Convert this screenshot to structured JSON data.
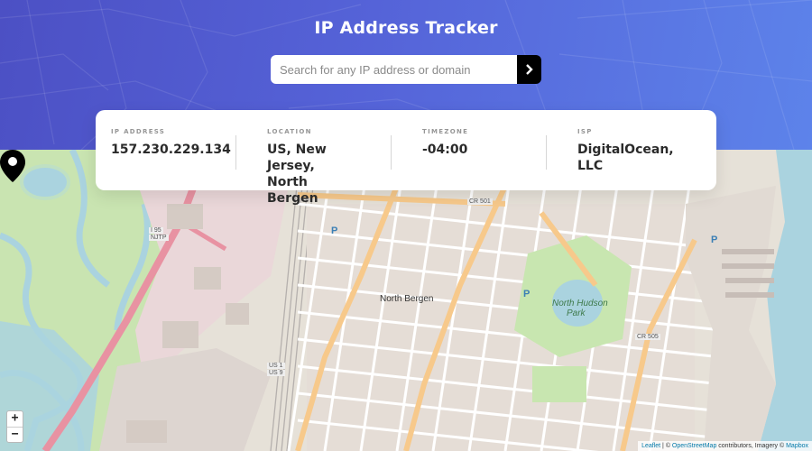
{
  "header": {
    "title": "IP Address Tracker",
    "accent_gradient": [
      "#4c50c4",
      "#5d83ea"
    ]
  },
  "search": {
    "placeholder": "Search for any IP address or domain",
    "value": "",
    "button_icon": "chevron-right-icon"
  },
  "info": {
    "ip_label": "IP ADDRESS",
    "ip_value": "157.230.229.134",
    "location_label": "LOCATION",
    "location_value_lines": [
      "US, New",
      "Jersey,",
      "North",
      "Bergen"
    ],
    "timezone_label": "TIMEZONE",
    "timezone_value": "-04:00",
    "isp_label": "ISP",
    "isp_value_lines": [
      "DigitalOcean,",
      "LLC"
    ]
  },
  "map": {
    "zoom_in": "+",
    "zoom_out": "−",
    "marker_icon": "location-pin-icon",
    "labels": {
      "neighborhood": "North Bergen",
      "park": "North Hudson",
      "park2": "Park",
      "route_cr501": "CR 501",
      "route_cr505": "CR 505",
      "route_i95": "I 95",
      "route_nitp": "NJTP",
      "route_us1": "US 1",
      "route_us9": "US 9",
      "parking": "P"
    },
    "attribution": {
      "leaflet": "Leaflet",
      "sep": " | © ",
      "osm": "OpenStreetMap",
      "mid": " contributors, Imagery © ",
      "mapbox": "Mapbox"
    },
    "colors": {
      "land": "#e6e1d8",
      "water": "#aad3df",
      "green": "#c8e6b0",
      "road_major": "#f7c98b",
      "road_motorway": "#e892a2",
      "building": "#d9d0c9"
    }
  }
}
